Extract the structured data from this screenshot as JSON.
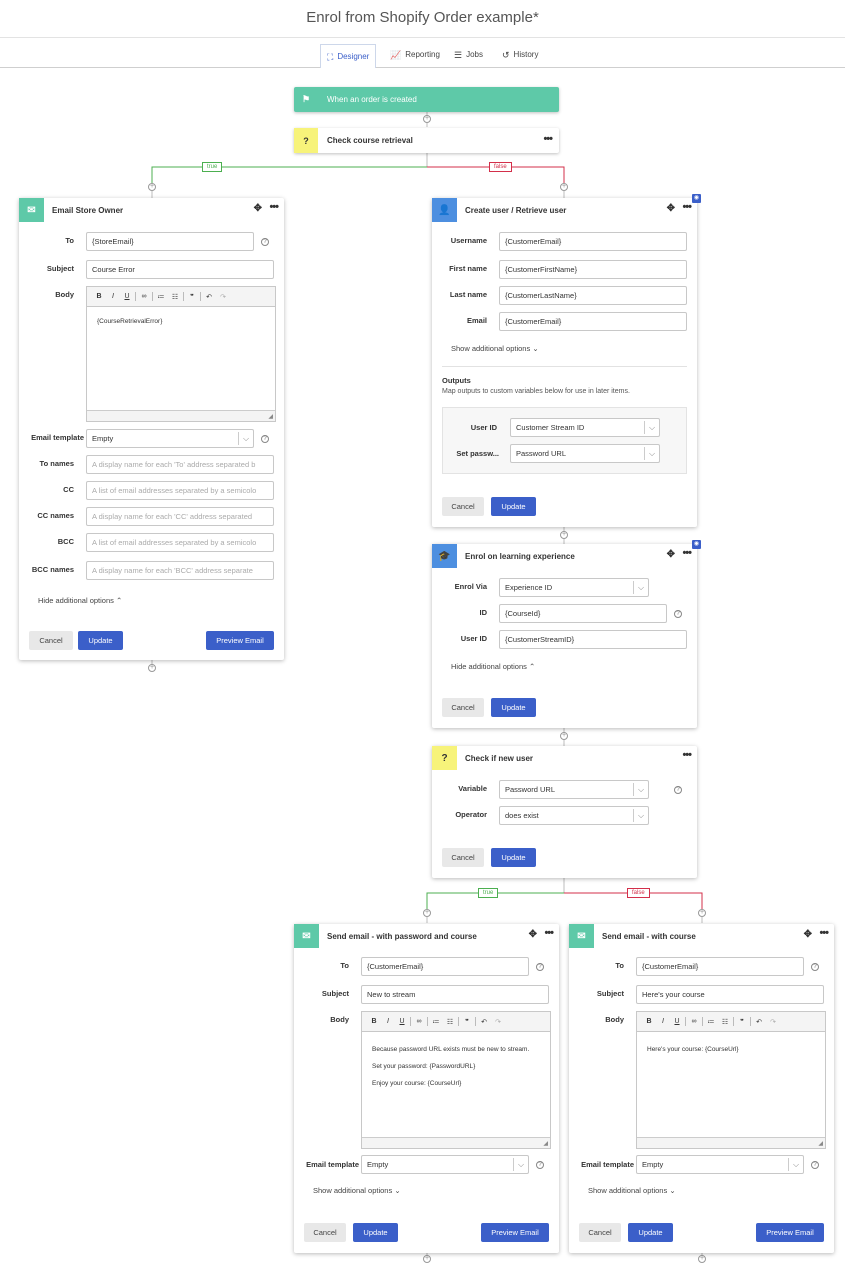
{
  "page": {
    "title": "Enrol from Shopify Order example*"
  },
  "tabs": [
    {
      "label": "Designer",
      "icon": "sitemap-icon"
    },
    {
      "label": "Reporting",
      "icon": "chart-icon"
    },
    {
      "label": "Jobs",
      "icon": "list-icon"
    },
    {
      "label": "History",
      "icon": "history-icon"
    }
  ],
  "colors": {
    "trigger": "#5ec9a8",
    "condition": "#f7f37a",
    "email": "#5ec9a8",
    "user": "#4d8fe0",
    "primary": "#3b5fc9",
    "true": "#4caf50",
    "false": "#d32f4a"
  },
  "conditions": {
    "true_label": "true",
    "false_label": "false"
  },
  "trigger": {
    "label": "When an order is created",
    "icon": "flag-icon"
  },
  "check_course": {
    "label": "Check course retrieval",
    "icon_text": "?",
    "menu": "•••"
  },
  "email_owner": {
    "title": "Email Store Owner",
    "to_label": "To",
    "to_value": "{StoreEmail}",
    "subject_label": "Subject",
    "subject_value": "Course Error",
    "body_label": "Body",
    "body_lines": [
      "{CourseRetrievalError}"
    ],
    "template_label": "Email template",
    "template_value": "Empty",
    "to_names_label": "To names",
    "to_names_placeholder": "A display name for each 'To' address separated b",
    "cc_label": "CC",
    "cc_placeholder": "A list of email addresses separated by a semicolo",
    "cc_names_label": "CC names",
    "cc_names_placeholder": "A display name for each 'CC' address separated",
    "bcc_label": "BCC",
    "bcc_placeholder": "A list of email addresses separated by a semicolo",
    "bcc_names_label": "BCC names",
    "bcc_names_placeholder": "A display name for each 'BCC' address separate",
    "options_link": "Hide additional options",
    "cancel": "Cancel",
    "update": "Update",
    "preview": "Preview Email"
  },
  "create_user": {
    "title": "Create user / Retrieve user",
    "username_label": "Username",
    "username_value": "{CustomerEmail}",
    "first_label": "First name",
    "first_value": "{CustomerFirstName}",
    "last_label": "Last name",
    "last_value": "{CustomerLastName}",
    "email_label": "Email",
    "email_value": "{CustomerEmail}",
    "options_link": "Show additional options",
    "outputs_title": "Outputs",
    "outputs_note": "Map outputs to custom variables below for use in later items.",
    "userid_label": "User ID",
    "userid_value": "Customer Stream ID",
    "setpass_label": "Set passw...",
    "setpass_value": "Password URL",
    "cancel": "Cancel",
    "update": "Update"
  },
  "enrol": {
    "title": "Enrol on learning experience",
    "via_label": "Enrol Via",
    "via_value": "Experience ID",
    "id_label": "ID",
    "id_value": "{CourseId}",
    "userid_label": "User ID",
    "userid_value": "{CustomerStreamID}",
    "options_link": "Hide additional options",
    "cancel": "Cancel",
    "update": "Update"
  },
  "check_user": {
    "title": "Check if new user",
    "icon_text": "?",
    "variable_label": "Variable",
    "variable_value": "Password URL",
    "operator_label": "Operator",
    "operator_value": "does exist",
    "cancel": "Cancel",
    "update": "Update"
  },
  "email_pw": {
    "title": "Send email - with password and course",
    "to_label": "To",
    "to_value": "{CustomerEmail}",
    "subject_label": "Subject",
    "subject_value": "New to stream",
    "body_label": "Body",
    "body_lines": [
      "Because password URL exists must be new to stream.",
      "Set your password: {PasswordURL}",
      "Enjoy your course: {CourseUrl}"
    ],
    "template_label": "Email template",
    "template_value": "Empty",
    "options_link": "Show additional options",
    "cancel": "Cancel",
    "update": "Update",
    "preview": "Preview Email"
  },
  "email_course": {
    "title": "Send email - with course",
    "to_label": "To",
    "to_value": "{CustomerEmail}",
    "subject_label": "Subject",
    "subject_value": "Here's your course",
    "body_label": "Body",
    "body_lines": [
      "Here's your course: {CourseUrl}"
    ],
    "template_label": "Email template",
    "template_value": "Empty",
    "options_link": "Show additional options",
    "cancel": "Cancel",
    "update": "Update",
    "preview": "Preview Email"
  }
}
